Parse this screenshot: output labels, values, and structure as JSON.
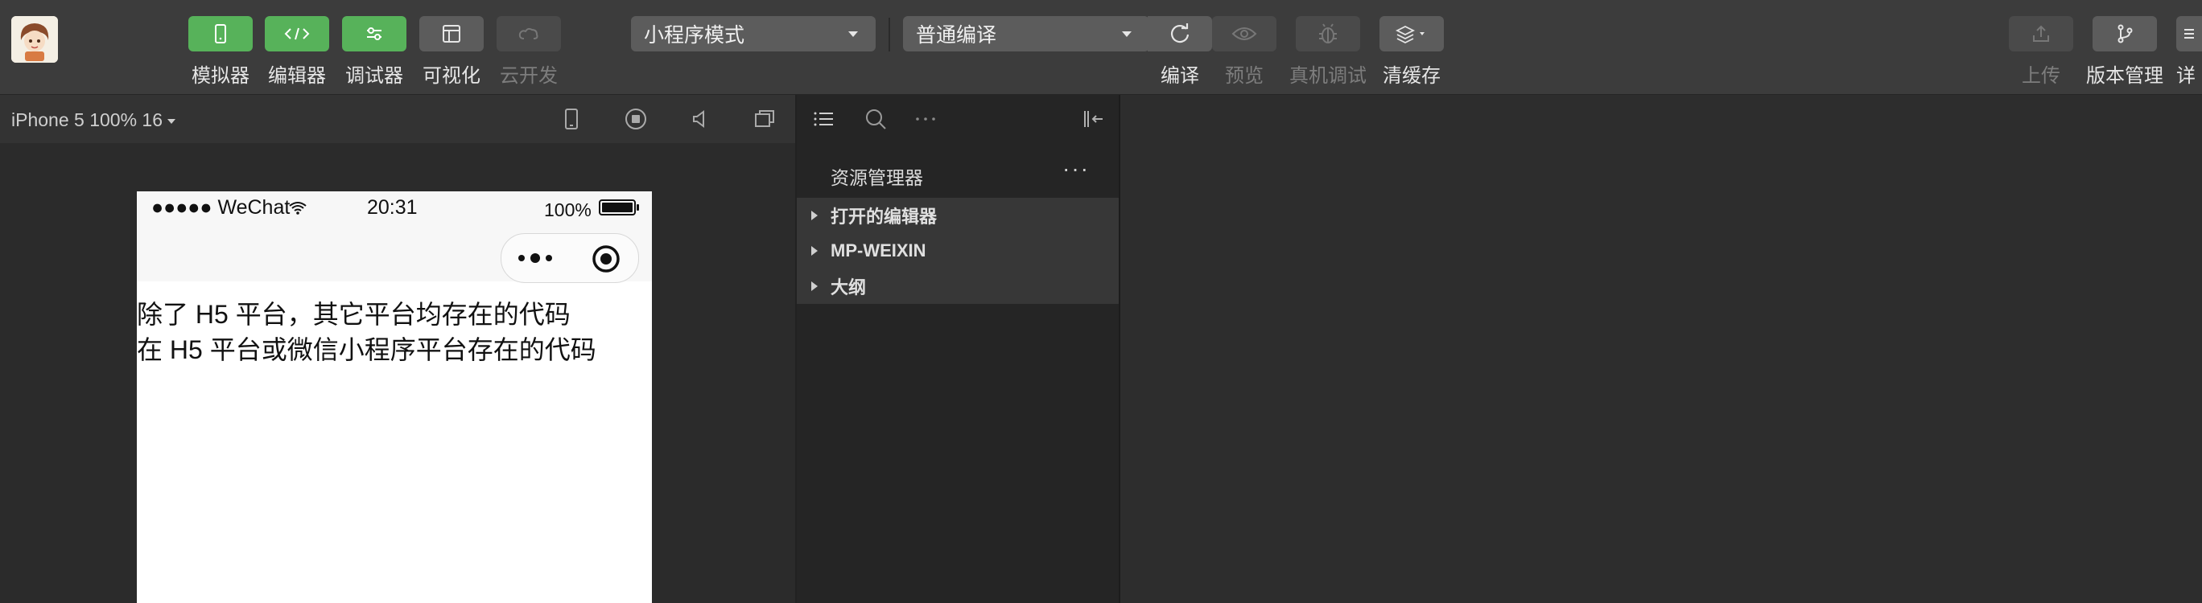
{
  "toolbar": {
    "tools": [
      {
        "label": "模拟器",
        "icon": "phone-icon",
        "style": "green"
      },
      {
        "label": "编辑器",
        "icon": "code-icon",
        "style": "green"
      },
      {
        "label": "调试器",
        "icon": "sliders-icon",
        "style": "green"
      },
      {
        "label": "可视化",
        "icon": "layout-icon",
        "style": "grey"
      },
      {
        "label": "云开发",
        "icon": "cloud-icon",
        "style": "disabled"
      }
    ],
    "mode_select": "小程序模式",
    "compile_select": "普通编译",
    "actions": [
      {
        "label": "编译",
        "icon": "refresh-icon"
      },
      {
        "label": "预览",
        "icon": "eye-icon"
      },
      {
        "label": "真机调试",
        "icon": "bug-icon"
      },
      {
        "label": "清缓存",
        "icon": "layers-icon"
      }
    ],
    "right": [
      {
        "label": "上传",
        "icon": "upload-icon"
      },
      {
        "label": "版本管理",
        "icon": "branch-icon"
      },
      {
        "label": "详",
        "icon": "details-icon"
      }
    ]
  },
  "simulator": {
    "device_label": "iPhone 5 100% 16",
    "status": {
      "carrier": "●●●●● WeChat",
      "time": "20:31",
      "battery": "100%"
    },
    "lines": [
      "除了 H5 平台，其它平台均存在的代码",
      "在 H5 平台或微信小程序平台存在的代码"
    ]
  },
  "explorer": {
    "title": "资源管理器",
    "more": "···",
    "sections": [
      "打开的编辑器",
      "MP-WEIXIN",
      "大纲"
    ]
  },
  "colors": {
    "accent_green": "#57b25a",
    "toolbar_bg": "#3c3c3c",
    "panel_bg": "#252525"
  }
}
